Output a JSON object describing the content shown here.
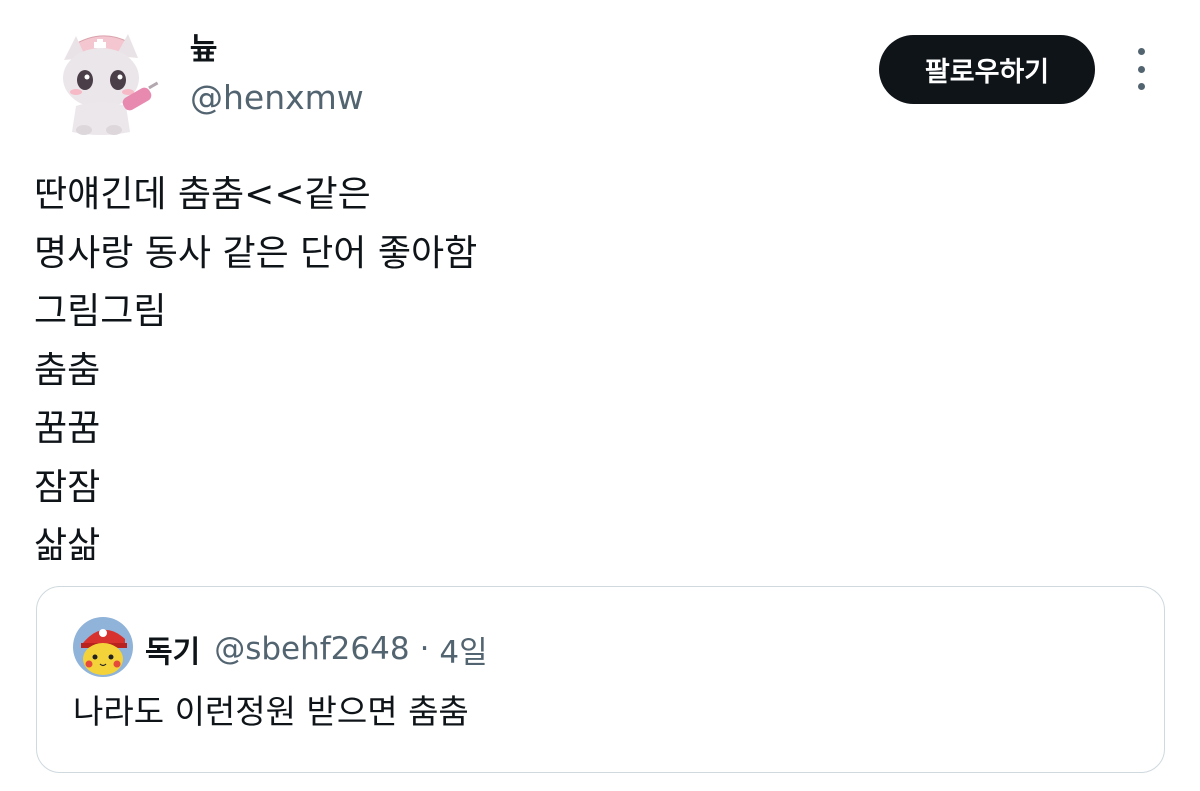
{
  "author": {
    "display_name": "늎",
    "handle": "@henxmw",
    "avatar_icon": "pink-cat-nurse-avatar"
  },
  "actions": {
    "follow_label": "팔로우하기",
    "more_icon": "more-vertical-icon"
  },
  "tweet": {
    "lines": [
      "딴얘긴데 춤춤<<같은",
      "명사랑 동사 같은 단어 좋아함",
      "그림그림",
      "춤춤",
      "꿈꿈",
      "잠잠",
      "삶삶"
    ]
  },
  "quote": {
    "display_name": "독기",
    "handle": "@sbehf2648",
    "separator": "·",
    "time": "4일",
    "text": "나라도 이런정원 받으면 춤춤",
    "avatar_icon": "pikachu-red-cap-avatar"
  },
  "colors": {
    "text_primary": "#0f1419",
    "text_secondary": "#536471",
    "follow_bg": "#0f1419",
    "border": "#cfd9de"
  }
}
